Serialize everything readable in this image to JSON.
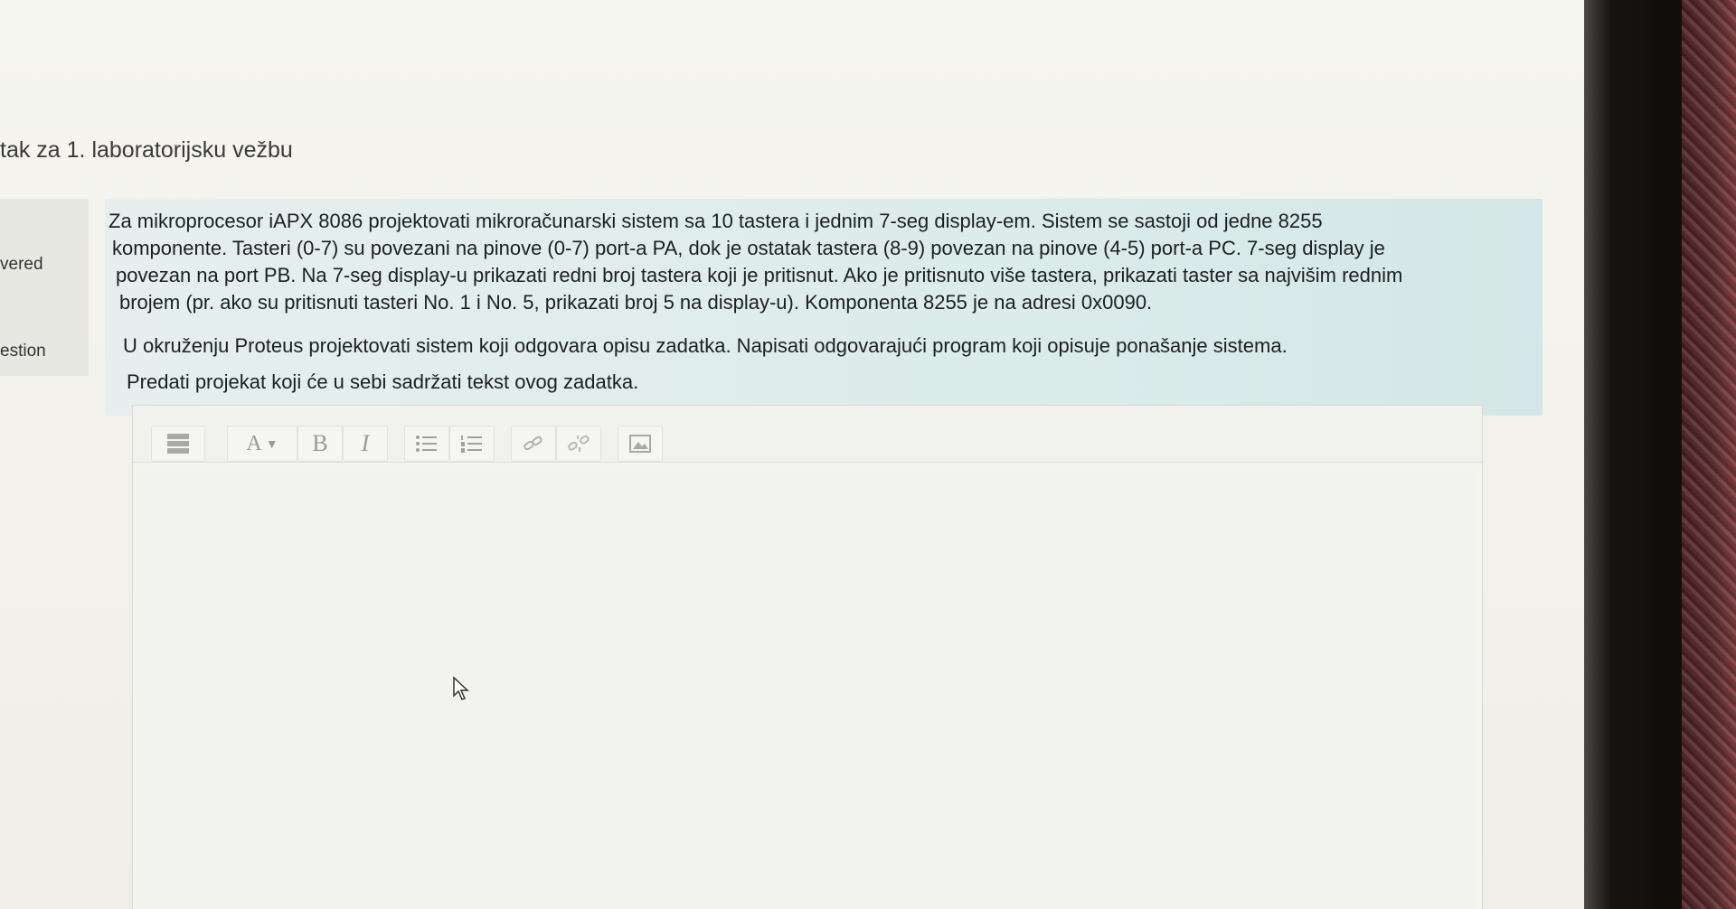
{
  "page": {
    "heading": "tak za 1. laboratorijsku vežbu"
  },
  "info": {
    "status_partial": "vered",
    "flag_partial": "estion"
  },
  "question": {
    "lines": [
      "Za mikroprocesor iAPX 8086 projektovati mikroračunarski sistem sa 10 tastera i jednim 7-seg display-em. Sistem se sastoji od jedne 8255",
      "komponente. Tasteri (0-7) su povezani na pinove (0-7) port-a PA, dok je ostatak tastera (8-9) povezan na pinove (4-5) port-a PC. 7-seg display je",
      "povezan na port PB. Na 7-seg display-u prikazati redni broj tastera koji je pritisnut. Ako je pritisnuto više tastera, prikazati taster sa najvišim rednim",
      "brojem (pr. ako su pritisnuti tasteri No. 1 i No. 5, prikazati broj 5 na display-u). Komponenta 8255 je na adresi 0x0090.",
      "U okruženju Proteus projektovati sistem koji odgovara opisu zadatka. Napisati odgovarajući program koji opisuje ponašanje sistema.",
      "Predati projekat koji će u sebi sadržati tekst ovog zadatka."
    ]
  },
  "editor": {
    "toolbar": {
      "font_glyph": "A",
      "bold_glyph": "B",
      "italic_glyph": "I"
    },
    "content": ""
  }
}
